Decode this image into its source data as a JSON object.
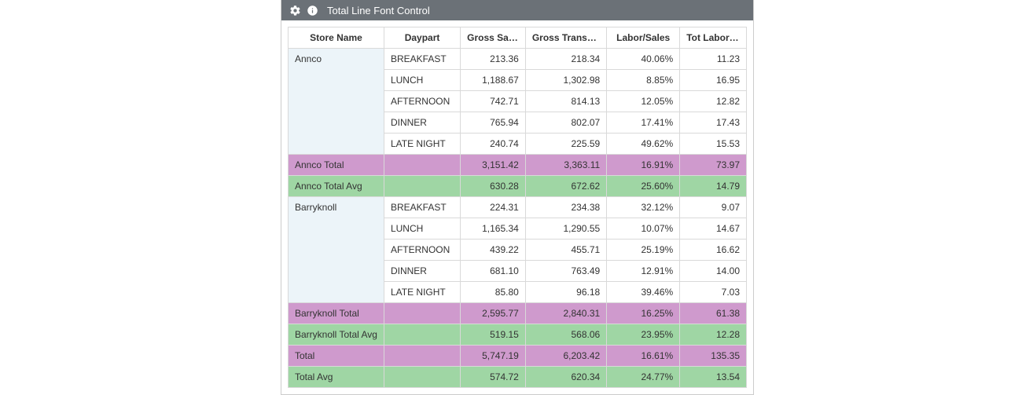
{
  "header": {
    "title": "Total Line Font Control"
  },
  "columns": [
    "Store Name",
    "Daypart",
    "Gross Sales",
    "Gross Transactions",
    "Labor/Sales",
    "Tot Labor Hrs"
  ],
  "stores": [
    {
      "name": "Annco",
      "rows": [
        {
          "daypart": "BREAKFAST",
          "gross_sales": "213.36",
          "gross_transactions": "218.34",
          "labor_sales": "40.06%",
          "tot_labor_hrs": "11.23"
        },
        {
          "daypart": "LUNCH",
          "gross_sales": "1,188.67",
          "gross_transactions": "1,302.98",
          "labor_sales": "8.85%",
          "tot_labor_hrs": "16.95"
        },
        {
          "daypart": "AFTERNOON",
          "gross_sales": "742.71",
          "gross_transactions": "814.13",
          "labor_sales": "12.05%",
          "tot_labor_hrs": "12.82"
        },
        {
          "daypart": "DINNER",
          "gross_sales": "765.94",
          "gross_transactions": "802.07",
          "labor_sales": "17.41%",
          "tot_labor_hrs": "17.43"
        },
        {
          "daypart": "LATE NIGHT",
          "gross_sales": "240.74",
          "gross_transactions": "225.59",
          "labor_sales": "49.62%",
          "tot_labor_hrs": "15.53"
        }
      ],
      "total": {
        "label": "Annco Total",
        "gross_sales": "3,151.42",
        "gross_transactions": "3,363.11",
        "labor_sales": "16.91%",
        "tot_labor_hrs": "73.97"
      },
      "totalAvg": {
        "label": "Annco Total Avg",
        "gross_sales": "630.28",
        "gross_transactions": "672.62",
        "labor_sales": "25.60%",
        "tot_labor_hrs": "14.79"
      }
    },
    {
      "name": "Barryknoll",
      "rows": [
        {
          "daypart": "BREAKFAST",
          "gross_sales": "224.31",
          "gross_transactions": "234.38",
          "labor_sales": "32.12%",
          "tot_labor_hrs": "9.07"
        },
        {
          "daypart": "LUNCH",
          "gross_sales": "1,165.34",
          "gross_transactions": "1,290.55",
          "labor_sales": "10.07%",
          "tot_labor_hrs": "14.67"
        },
        {
          "daypart": "AFTERNOON",
          "gross_sales": "439.22",
          "gross_transactions": "455.71",
          "labor_sales": "25.19%",
          "tot_labor_hrs": "16.62"
        },
        {
          "daypart": "DINNER",
          "gross_sales": "681.10",
          "gross_transactions": "763.49",
          "labor_sales": "12.91%",
          "tot_labor_hrs": "14.00"
        },
        {
          "daypart": "LATE NIGHT",
          "gross_sales": "85.80",
          "gross_transactions": "96.18",
          "labor_sales": "39.46%",
          "tot_labor_hrs": "7.03"
        }
      ],
      "total": {
        "label": "Barryknoll Total",
        "gross_sales": "2,595.77",
        "gross_transactions": "2,840.31",
        "labor_sales": "16.25%",
        "tot_labor_hrs": "61.38"
      },
      "totalAvg": {
        "label": "Barryknoll Total Avg",
        "gross_sales": "519.15",
        "gross_transactions": "568.06",
        "labor_sales": "23.95%",
        "tot_labor_hrs": "12.28"
      }
    }
  ],
  "grandTotal": {
    "label": "Total",
    "gross_sales": "5,747.19",
    "gross_transactions": "6,203.42",
    "labor_sales": "16.61%",
    "tot_labor_hrs": "135.35"
  },
  "grandTotalAvg": {
    "label": "Total Avg",
    "gross_sales": "574.72",
    "gross_transactions": "620.34",
    "labor_sales": "24.77%",
    "tot_labor_hrs": "13.54"
  }
}
